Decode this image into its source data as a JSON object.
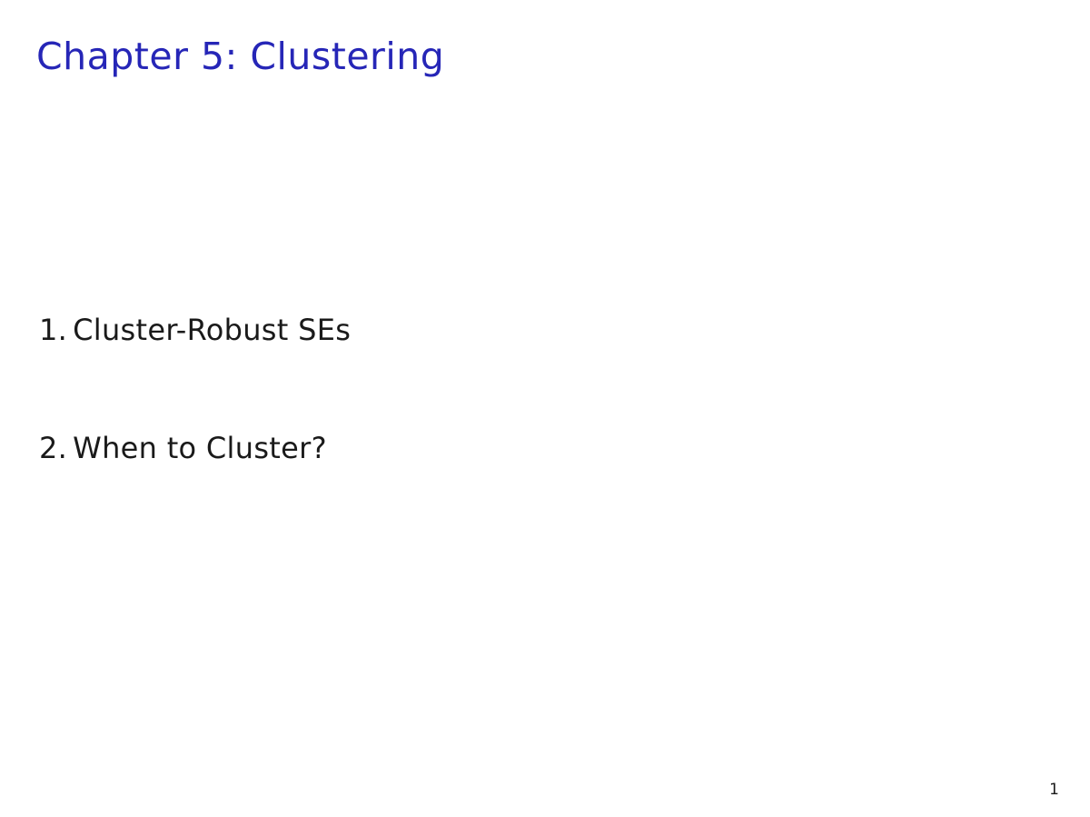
{
  "slide": {
    "title": "Chapter 5: Clustering",
    "items": [
      {
        "number": "1.",
        "text": "Cluster-Robust SEs"
      },
      {
        "number": "2.",
        "text": "When to Cluster?"
      }
    ],
    "page_number": "1"
  }
}
